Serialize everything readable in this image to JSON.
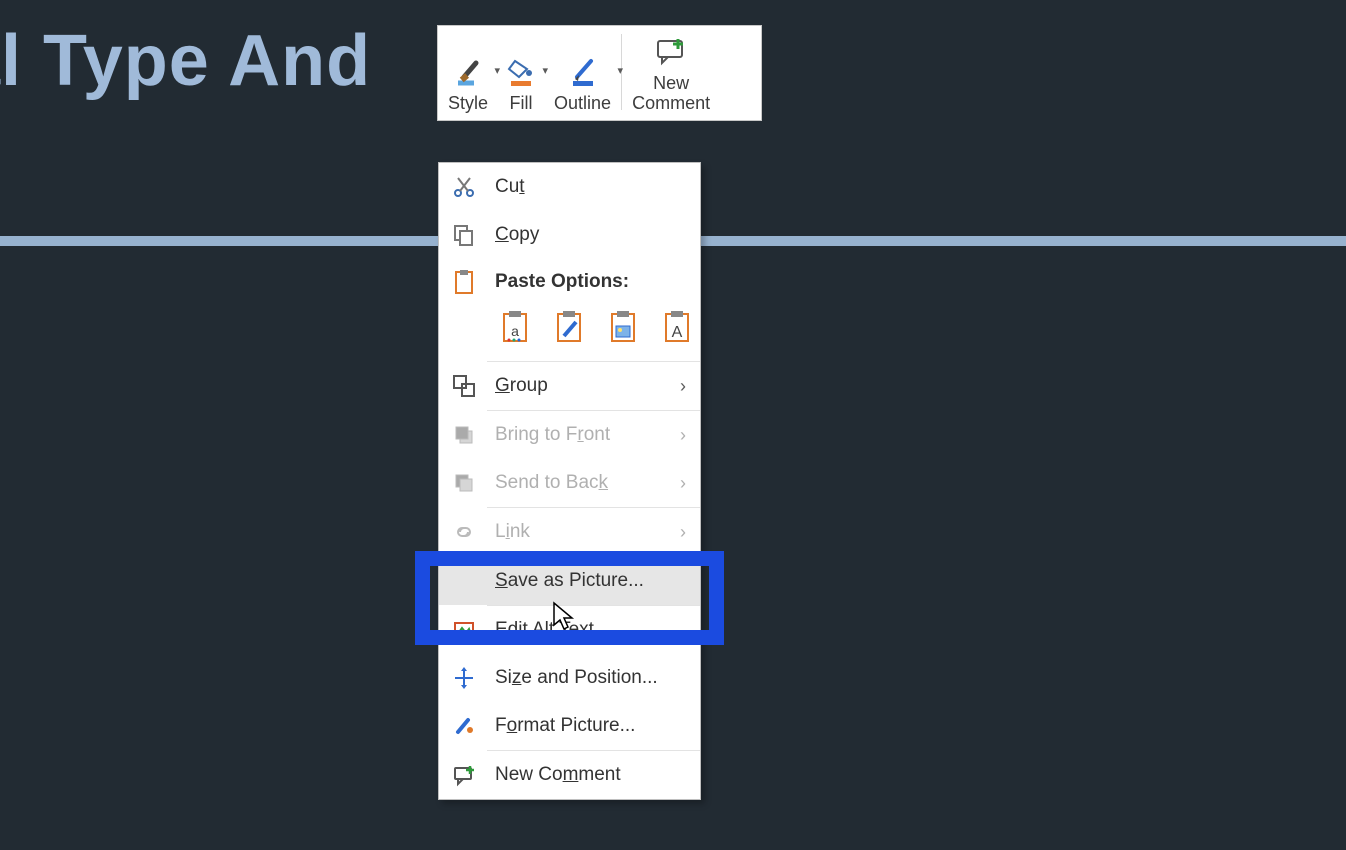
{
  "background": {
    "partial_title_text": "al Type And"
  },
  "mini_toolbar": {
    "style_label": "Style",
    "fill_label": "Fill",
    "outline_label": "Outline",
    "new_comment_label_line1": "New",
    "new_comment_label_line2": "Comment"
  },
  "context_menu": {
    "cut": "Cut",
    "copy": "Copy",
    "paste_options_header": "Paste Options:",
    "group": "Group",
    "bring_to_front": "Bring to Front",
    "send_to_back": "Send to Back",
    "link": "Link",
    "save_as_picture": "Save as Picture...",
    "edit_alt_text": "Edit Alt Text...",
    "size_and_position": "Size and Position...",
    "format_picture": "Format Picture...",
    "new_comment": "New Comment"
  },
  "highlighted_item": "save_as_picture"
}
